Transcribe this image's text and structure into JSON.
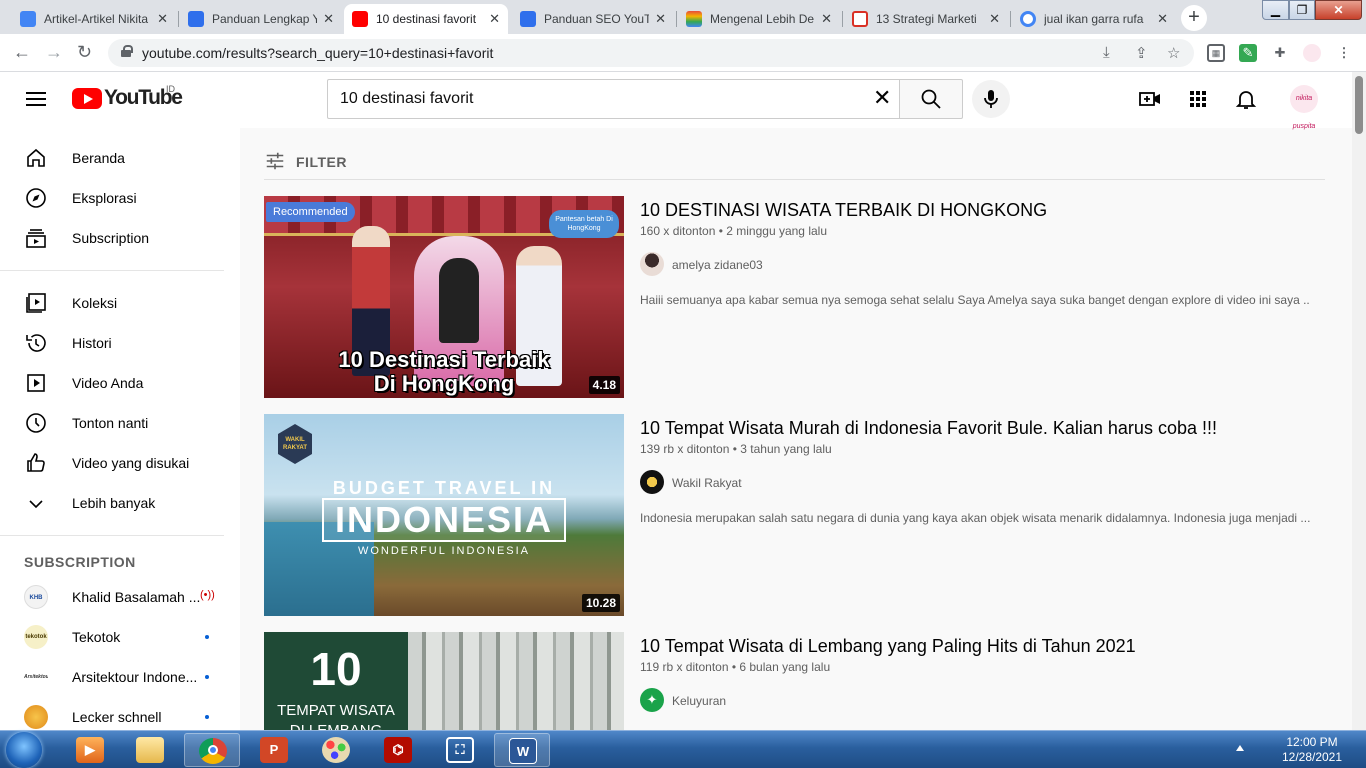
{
  "browser": {
    "tabs": [
      {
        "title": "Artikel-Artikel Nikita",
        "favicon_color": "#4285f4"
      },
      {
        "title": "Panduan Lengkap Y",
        "favicon_color": "#2f6fec"
      },
      {
        "title": "10 destinasi favorit",
        "favicon_color": "#ff0000"
      },
      {
        "title": "Panduan SEO YouTu",
        "favicon_color": "#2f6fec"
      },
      {
        "title": "Mengenal Lebih De",
        "favicon_color": "#e2a12c"
      },
      {
        "title": "13 Strategi Marketi",
        "favicon_color": "#d93025"
      },
      {
        "title": "jual ikan garra rufa",
        "favicon_color": "#4285f4"
      }
    ],
    "url": "youtube.com/results?search_query=10+destinasi+favorit"
  },
  "youtube": {
    "logo_text": "YouTube",
    "country_code": "ID",
    "search_value": "10 destinasi favorit",
    "avatar_text": "nikita puspita"
  },
  "sidebar": {
    "main": [
      {
        "label": "Beranda"
      },
      {
        "label": "Eksplorasi"
      },
      {
        "label": "Subscription"
      }
    ],
    "library": [
      {
        "label": "Koleksi"
      },
      {
        "label": "Histori"
      },
      {
        "label": "Video Anda"
      },
      {
        "label": "Tonton nanti"
      },
      {
        "label": "Video yang disukai"
      },
      {
        "label": "Lebih banyak"
      }
    ],
    "subscription_heading": "SUBSCRIPTION",
    "subscriptions": [
      {
        "label": "Khalid Basalamah ...",
        "avatar_text": "KHB"
      },
      {
        "label": "Tekotok",
        "avatar_text": "tekotok"
      },
      {
        "label": "Arsitektour Indone...",
        "avatar_text": "Arsitektour"
      },
      {
        "label": "Lecker schnell",
        "avatar_text": ""
      }
    ]
  },
  "filter_label": "FILTER",
  "results": [
    {
      "title": "10 DESTINASI WISATA TERBAIK DI HONGKONG",
      "meta": "160 x ditonton • 2 minggu yang lalu",
      "channel": "amelya zidane03",
      "description": "Haiii semuanya apa kabar semua nya semoga sehat selalu Saya Amelya saya suka banget dengan explore di video ini saya ...",
      "duration": "4.18",
      "badge": "Recommended",
      "thumb_line1": "10 Destinasi Terbaik",
      "thumb_line2": "Di HongKong",
      "thumb_sign": "Pantesan betah Di HongKong"
    },
    {
      "title": "10 Tempat Wisata Murah di Indonesia Favorit Bule. Kalian harus coba !!!",
      "meta": "139 rb x ditonton • 3 tahun yang lalu",
      "channel": "Wakil Rakyat",
      "description": "Indonesia merupakan salah satu negara di dunia yang kaya akan objek wisata menarik didalamnya. Indonesia juga menjadi ...",
      "duration": "10.28",
      "thumb_line1": "BUDGET TRAVEL IN",
      "thumb_line2": "INDONESIA",
      "thumb_line3": "WONDERFUL INDONESIA",
      "thumb_logo": "WAKIL RAKYAT"
    },
    {
      "title": "10 Tempat Wisata di Lembang yang Paling Hits di Tahun 2021",
      "meta": "119 rb x ditonton • 6 bulan yang lalu",
      "channel": "Keluyuran",
      "thumb_line1": "10",
      "thumb_line2": "TEMPAT WISATA",
      "thumb_line3": "DI LEMBANG"
    }
  ],
  "taskbar": {
    "time": "12:00 PM",
    "date": "12/28/2021"
  }
}
